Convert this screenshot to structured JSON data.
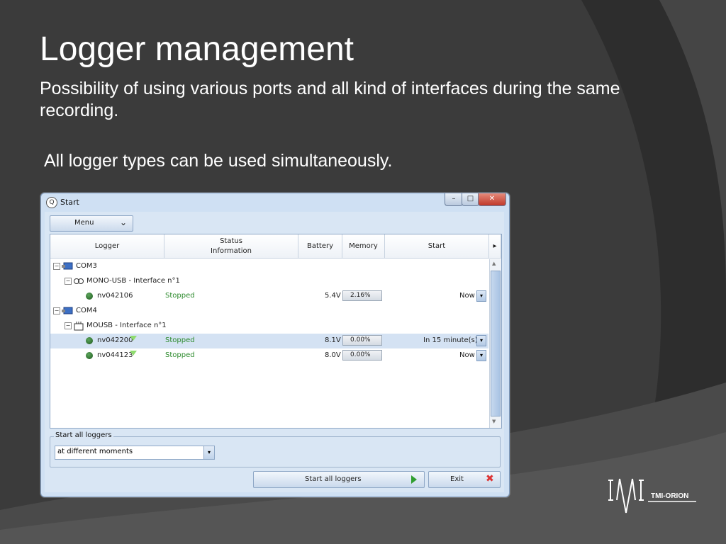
{
  "slide": {
    "title": "Logger management",
    "paragraph1": "Possibility of using various ports and all kind of interfaces during the same recording.",
    "paragraph2": "All logger types can be used simultaneously."
  },
  "window": {
    "title": "Start",
    "app_icon": "Q",
    "controls": {
      "minimize": "–",
      "maximize": "□",
      "close": "✕"
    }
  },
  "menu": {
    "label": "Menu",
    "chevron": "⌄"
  },
  "grid": {
    "columns": {
      "logger": "Logger",
      "status_line1": "Status",
      "status_line2": "Information",
      "battery": "Battery",
      "memory": "Memory",
      "start": "Start"
    },
    "header_more": "▸",
    "rows": [
      {
        "kind": "port",
        "label": "COM3"
      },
      {
        "kind": "interface",
        "label": "MONO-USB - Interface  n°1"
      },
      {
        "kind": "logger",
        "id": "nv042106",
        "status": "Stopped",
        "battery": "5.4V",
        "memory": "2.16%",
        "memory_fraction": 0.0216,
        "start": "Now"
      },
      {
        "kind": "port",
        "label": "COM4"
      },
      {
        "kind": "interface",
        "label": "MOUSB - Interface  n°1"
      },
      {
        "kind": "logger",
        "id": "nv042200",
        "status": "Stopped",
        "battery": "8.1V",
        "memory": "0.00%",
        "memory_fraction": 0.0,
        "start": "In 15 minute(s)",
        "selected": true
      },
      {
        "kind": "logger",
        "id": "nv044123",
        "status": "Stopped",
        "battery": "8.0V",
        "memory": "0.00%",
        "memory_fraction": 0.0,
        "start": "Now"
      }
    ],
    "expander_symbol": "−",
    "dropdown_symbol": "▾"
  },
  "start_all": {
    "legend": "Start all loggers",
    "mode_value": "at different moments",
    "dropdown_symbol": "▾"
  },
  "buttons": {
    "start_all_label": "Start all loggers",
    "exit_label": "Exit",
    "exit_icon": "✖"
  },
  "logo": {
    "text": "TMI-ORION"
  },
  "colors": {
    "status_green": "#2c8a2c",
    "selected_row": "#d4e2f3",
    "slide_bg": "#3a3a3a"
  }
}
